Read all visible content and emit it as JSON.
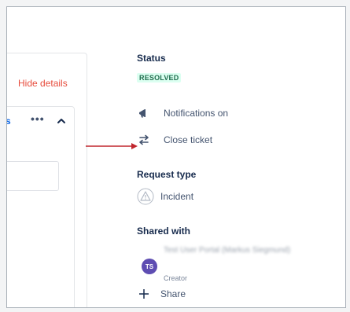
{
  "left_panel": {
    "hide_details_label": "Hide details",
    "tab_fragment": "s",
    "more_icon": "more-icon",
    "chevron_icon": "chevron-up-icon"
  },
  "details": {
    "status_label": "Status",
    "status_value": "RESOLVED",
    "notifications_label": "Notifications on",
    "close_ticket_label": "Close ticket",
    "request_type_label": "Request type",
    "request_type_value": "Incident",
    "shared_with_label": "Shared with",
    "shared_user_initials": "TS",
    "shared_user_name": "Test User Portal (Markus Siegmund)",
    "shared_user_role": "Creator",
    "share_label": "Share"
  },
  "colors": {
    "accent_red": "#e74c3c",
    "badge_text": "#216e4e",
    "badge_bg": "#dcfff1",
    "avatar_bg": "#5e4db2",
    "arrow": "#c0262d"
  }
}
